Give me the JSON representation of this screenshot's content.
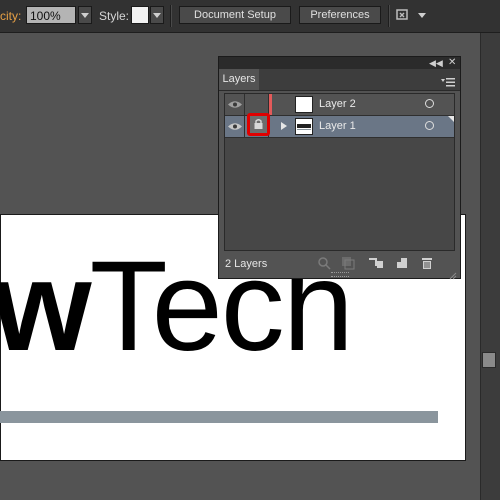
{
  "control_bar": {
    "opacity_label": "city:",
    "opacity_value": "100%",
    "style_label": "Style:",
    "document_setup_label": "Document Setup",
    "preferences_label": "Preferences",
    "arrange_icon": "arrange-documents-icon",
    "style_swatch_color": "#f2f2f2"
  },
  "artboard": {
    "text_bold": "w",
    "text_regular": "Tech",
    "underline_color": "#8a959d"
  },
  "layers_panel": {
    "tab_label": "Layers",
    "footer_count": "2 Layers",
    "layers": [
      {
        "name": "Layer 2",
        "visible": true,
        "locked": false,
        "color": "#e35a5a",
        "selected": false
      },
      {
        "name": "Layer 1",
        "visible": true,
        "locked": true,
        "color": "#6a7686",
        "selected": true
      }
    ],
    "footer_icons": [
      "locate-object-icon",
      "make-clipping-mask-icon",
      "create-sublayer-icon",
      "create-new-layer-icon",
      "delete-layer-icon"
    ],
    "highlight_color": "#e00000"
  }
}
